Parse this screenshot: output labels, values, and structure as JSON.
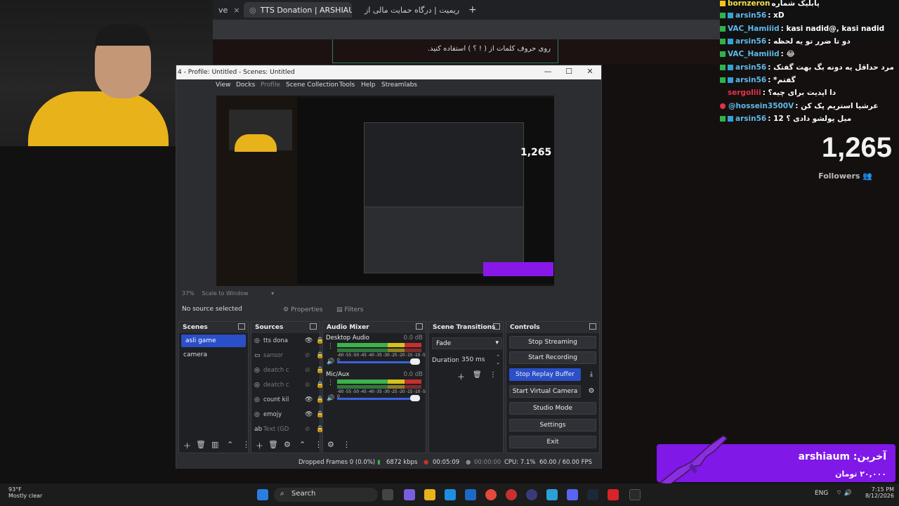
{
  "browser": {
    "tabs": [
      {
        "label": "ve",
        "active": false
      },
      {
        "label": "TTS Donation | ARSHIAUM",
        "active": true
      },
      {
        "label": "ریمیت | درگاه حمایت مالی از um",
        "active": false
      }
    ],
    "new_tab": "+",
    "donation_text": "روی حروف کلمات از ( ! ؟ ) استفاده کنید."
  },
  "chat": {
    "messages": [
      {
        "user": "bornzeron",
        "text": "پابلیک شماره",
        "color": "#f5e04a",
        "badge": "green"
      },
      {
        "user": "arsin56",
        "text": ": xD",
        "color": "#34a0d8",
        "badge": "green"
      },
      {
        "user": "VAC_Hamiiid",
        "text": ": kasi nadid@, kasi nadid",
        "color": "#34a0d8",
        "badge": "green"
      },
      {
        "user": "arsin56",
        "text": ": دو تا ضرر تو یه لحظه",
        "color": "#34a0d8",
        "badge": "green"
      },
      {
        "user": "VAC_Hamiiid",
        "text": ": 😂",
        "color": "#34a0d8",
        "badge": "green"
      },
      {
        "user": "arsin56",
        "text": ": مرد حداقل یه دونه بگ بهت گفتک",
        "color": "#34a0d8",
        "badge": "green"
      },
      {
        "user": "arsin56",
        "text": ": *گفتم",
        "color": "#34a0d8",
        "badge": "green"
      },
      {
        "user": "sergoliii",
        "text": ": دا اپدیت برای چیه؟",
        "color": "#e0334a",
        "badge": "none"
      },
      {
        "user": "@hossein3500V",
        "text": ": عرشیا استریم پک کن",
        "color": "#34a0d8",
        "badge": "red"
      },
      {
        "user": "arsin56",
        "text": ": میل پولشو دادی ؟ 12",
        "color": "#34a0d8",
        "badge": "green"
      }
    ]
  },
  "followers": {
    "count": "1,265",
    "label": "Followers"
  },
  "obs": {
    "title": "4 - Profile: Untitled - Scenes: Untitled",
    "menu": [
      "View",
      "Docks",
      "Profile",
      "Scene Collection",
      "Tools",
      "Help",
      "Streamlabs"
    ],
    "preview_zoom": "37%",
    "scale_mode": "Scale to Window",
    "no_source": "No source selected",
    "properties_label": "Properties",
    "filters_label": "Filters",
    "scenes": {
      "title": "Scenes",
      "items": [
        {
          "label": "asli game",
          "selected": true
        },
        {
          "label": "camera",
          "selected": false
        }
      ]
    },
    "sources": {
      "title": "Sources",
      "items": [
        {
          "label": "tts dona",
          "icon": "globe-icon",
          "visible": true
        },
        {
          "label": "sansor",
          "icon": "monitor-icon",
          "visible": false
        },
        {
          "label": "deatch c",
          "icon": "globe-icon",
          "visible": false
        },
        {
          "label": "deatch c",
          "icon": "globe-icon",
          "visible": false
        },
        {
          "label": "count kil",
          "icon": "globe-icon",
          "visible": true
        },
        {
          "label": "emojy",
          "icon": "globe-icon",
          "visible": true
        },
        {
          "label": "Text (GD",
          "icon": "text-icon",
          "visible": false
        }
      ]
    },
    "mixer": {
      "title": "Audio Mixer",
      "channels": [
        {
          "name": "Desktop Audio",
          "db": "0.0 dB"
        },
        {
          "name": "Mic/Aux",
          "db": "0.0 dB"
        }
      ],
      "scale": "-60 -55 -50 -45 -40 -35 -30 -25 -20 -15 -10 -5 0"
    },
    "transitions": {
      "title": "Scene Transitions",
      "selected": "Fade",
      "duration_label": "Duration",
      "duration_value": "350 ms"
    },
    "controls": {
      "title": "Controls",
      "buttons": [
        "Stop Streaming",
        "Start Recording",
        "Stop Replay Buffer",
        "Start Virtual Camera",
        "Studio Mode",
        "Settings",
        "Exit"
      ]
    },
    "status": {
      "dropped": "Dropped Frames 0 (0.0%)",
      "bitrate": "6872 kbps",
      "stream_time": "00:05:09",
      "rec_time": "00:00:00",
      "cpu": "CPU: 7.1%",
      "fps": "60.00 / 60.00 FPS"
    }
  },
  "alert": {
    "name": "آخرین: arshiaum",
    "amount": "۲۰,۰۰۰ تومان",
    "color": "#8018e8"
  },
  "taskbar": {
    "weather_temp": "93°F",
    "weather_desc": "Mostly clear",
    "search_placeholder": "Search",
    "lang": "ENG",
    "time": "7:15 PM",
    "date": "8/12/2026"
  }
}
